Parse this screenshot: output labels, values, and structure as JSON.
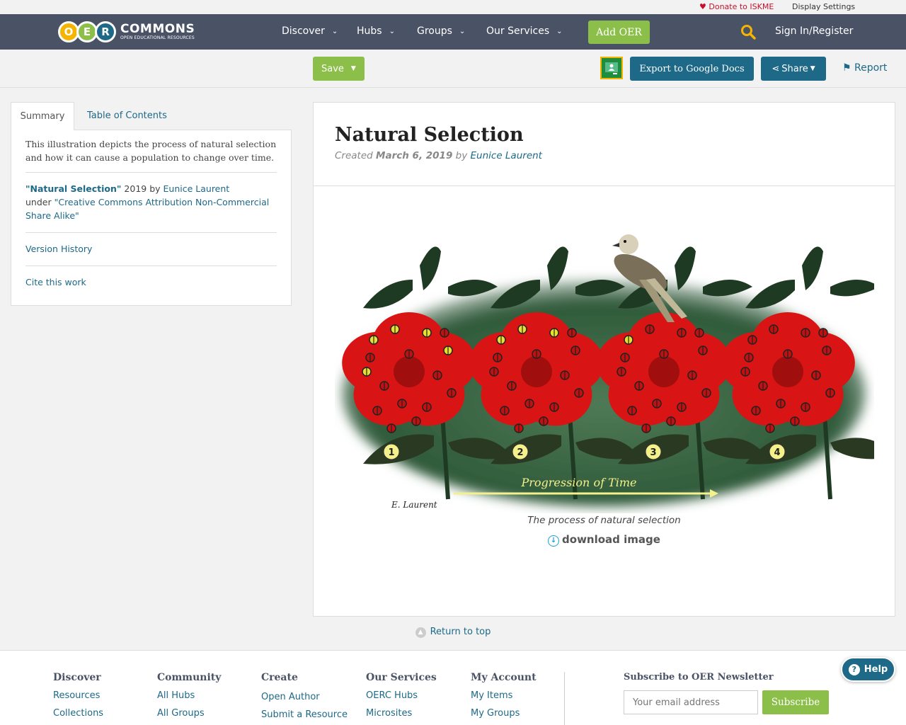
{
  "utility": {
    "donate": "Donate to ISKME",
    "display_settings": "Display Settings"
  },
  "logo": {
    "letters": [
      "O",
      "E",
      "R"
    ],
    "name": "COMMONS",
    "tagline": "OPEN EDUCATIONAL RESOURCES"
  },
  "nav": {
    "items": [
      {
        "label": "Discover"
      },
      {
        "label": "Hubs"
      },
      {
        "label": "Groups"
      },
      {
        "label": "Our Services"
      }
    ],
    "add_oer": "Add OER",
    "sign_in": "Sign In/Register"
  },
  "toolbar": {
    "save": "Save",
    "export": "Export to Google Docs",
    "share": "Share",
    "report": "Report"
  },
  "sidebar": {
    "tabs": [
      "Summary",
      "Table of Contents"
    ],
    "description": "This illustration depicts the process of natural selection and how it can cause a population to change over time.",
    "attribution": {
      "title": "\"Natural Selection\"",
      "year_by": " 2019 by ",
      "author": "Eunice Laurent",
      "under": "under ",
      "license": "\"Creative Commons Attribution Non-Commercial Share Alike\""
    },
    "version_history": "Version History",
    "cite": "Cite this work"
  },
  "main": {
    "title": "Natural Selection",
    "created_label": "Created",
    "date": "March 6, 2019",
    "by_label": "by",
    "author": "Eunice Laurent",
    "illustration": {
      "stage_labels": [
        "1",
        "2",
        "3",
        "4"
      ],
      "arrow_label": "Progression of Time",
      "signature": "E. Laurent"
    },
    "caption": "The process of natural selection",
    "download": "download image"
  },
  "return_to_top": "Return to top",
  "footer": {
    "columns": [
      {
        "heading": "Discover",
        "links": [
          "Resources",
          "Collections"
        ]
      },
      {
        "heading": "Community",
        "links": [
          "All Hubs",
          "All Groups"
        ]
      },
      {
        "heading": "Create",
        "links": [
          "Open Author",
          "Submit a Resource"
        ]
      },
      {
        "heading": "Our Services",
        "links": [
          "OERC Hubs",
          "Microsites"
        ]
      },
      {
        "heading": "My Account",
        "links": [
          "My Items",
          "My Groups"
        ]
      }
    ],
    "newsletter": {
      "heading": "Subscribe to OER Newsletter",
      "placeholder": "Your email address",
      "button": "Subscribe"
    }
  },
  "help": "Help",
  "colors": {
    "nav_bg": "#4a5266",
    "accent_green": "#8cbf4a",
    "primary_blue": "#1d6987",
    "donate_red": "#c8102e"
  }
}
